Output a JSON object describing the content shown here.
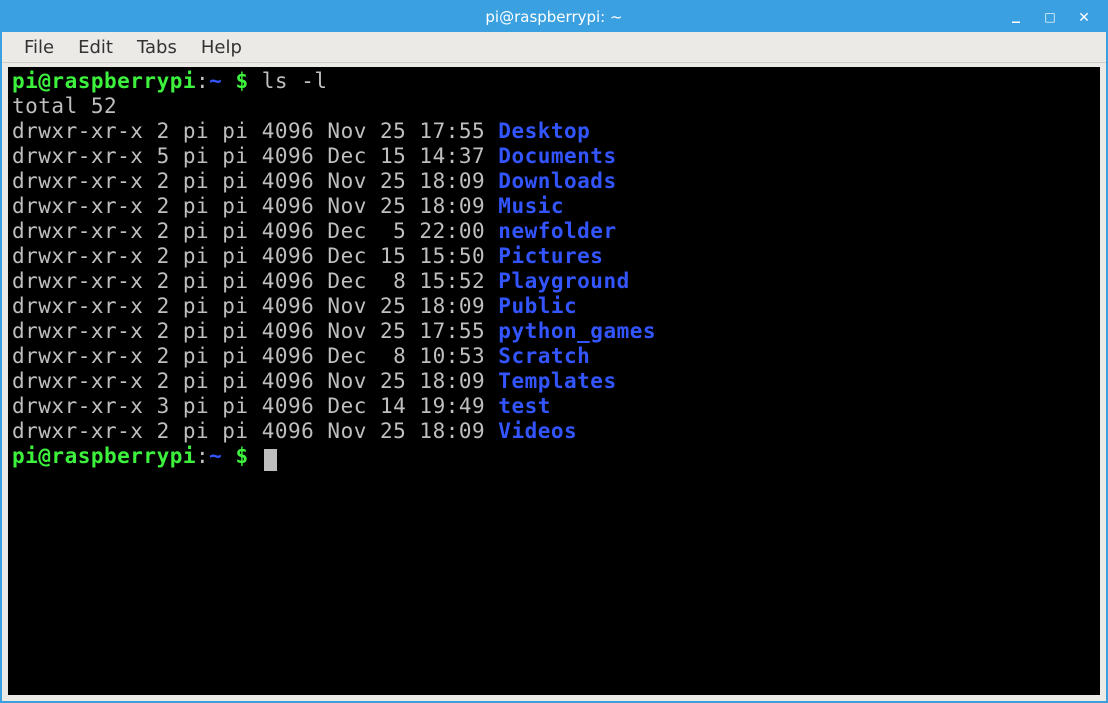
{
  "window": {
    "title": "pi@raspberrypi: ~"
  },
  "menu": {
    "file": "File",
    "edit": "Edit",
    "tabs": "Tabs",
    "help": "Help"
  },
  "prompt": {
    "userhost": "pi@raspberrypi",
    "colon": ":",
    "path": "~",
    "dollar": " $ "
  },
  "command": "ls -l",
  "total_line": "total 52",
  "listing": [
    {
      "perm": "drwxr-xr-x",
      "links": "2",
      "user": "pi",
      "group": "pi",
      "size": "4096",
      "mon": "Nov",
      "day": "25",
      "time": "17:55",
      "name": "Desktop"
    },
    {
      "perm": "drwxr-xr-x",
      "links": "5",
      "user": "pi",
      "group": "pi",
      "size": "4096",
      "mon": "Dec",
      "day": "15",
      "time": "14:37",
      "name": "Documents"
    },
    {
      "perm": "drwxr-xr-x",
      "links": "2",
      "user": "pi",
      "group": "pi",
      "size": "4096",
      "mon": "Nov",
      "day": "25",
      "time": "18:09",
      "name": "Downloads"
    },
    {
      "perm": "drwxr-xr-x",
      "links": "2",
      "user": "pi",
      "group": "pi",
      "size": "4096",
      "mon": "Nov",
      "day": "25",
      "time": "18:09",
      "name": "Music"
    },
    {
      "perm": "drwxr-xr-x",
      "links": "2",
      "user": "pi",
      "group": "pi",
      "size": "4096",
      "mon": "Dec",
      "day": " 5",
      "time": "22:00",
      "name": "newfolder"
    },
    {
      "perm": "drwxr-xr-x",
      "links": "2",
      "user": "pi",
      "group": "pi",
      "size": "4096",
      "mon": "Dec",
      "day": "15",
      "time": "15:50",
      "name": "Pictures"
    },
    {
      "perm": "drwxr-xr-x",
      "links": "2",
      "user": "pi",
      "group": "pi",
      "size": "4096",
      "mon": "Dec",
      "day": " 8",
      "time": "15:52",
      "name": "Playground"
    },
    {
      "perm": "drwxr-xr-x",
      "links": "2",
      "user": "pi",
      "group": "pi",
      "size": "4096",
      "mon": "Nov",
      "day": "25",
      "time": "18:09",
      "name": "Public"
    },
    {
      "perm": "drwxr-xr-x",
      "links": "2",
      "user": "pi",
      "group": "pi",
      "size": "4096",
      "mon": "Nov",
      "day": "25",
      "time": "17:55",
      "name": "python_games"
    },
    {
      "perm": "drwxr-xr-x",
      "links": "2",
      "user": "pi",
      "group": "pi",
      "size": "4096",
      "mon": "Dec",
      "day": " 8",
      "time": "10:53",
      "name": "Scratch"
    },
    {
      "perm": "drwxr-xr-x",
      "links": "2",
      "user": "pi",
      "group": "pi",
      "size": "4096",
      "mon": "Nov",
      "day": "25",
      "time": "18:09",
      "name": "Templates"
    },
    {
      "perm": "drwxr-xr-x",
      "links": "3",
      "user": "pi",
      "group": "pi",
      "size": "4096",
      "mon": "Dec",
      "day": "14",
      "time": "19:49",
      "name": "test"
    },
    {
      "perm": "drwxr-xr-x",
      "links": "2",
      "user": "pi",
      "group": "pi",
      "size": "4096",
      "mon": "Nov",
      "day": "25",
      "time": "18:09",
      "name": "Videos"
    }
  ]
}
